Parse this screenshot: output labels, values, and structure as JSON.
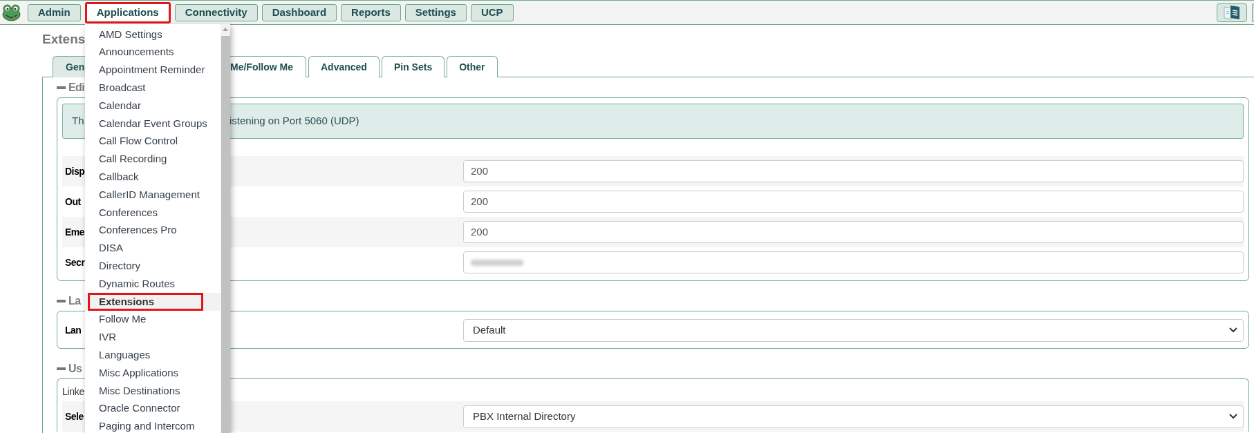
{
  "top_bar": {
    "nav": [
      {
        "label": "Admin",
        "selected": false,
        "highlighted": false
      },
      {
        "label": "Applications",
        "selected": true,
        "highlighted": true
      },
      {
        "label": "Connectivity",
        "selected": false,
        "highlighted": false
      },
      {
        "label": "Dashboard",
        "selected": false,
        "highlighted": false
      },
      {
        "label": "Reports",
        "selected": false,
        "highlighted": false
      },
      {
        "label": "Settings",
        "selected": false,
        "highlighted": false
      },
      {
        "label": "UCP",
        "selected": false,
        "highlighted": false
      }
    ]
  },
  "page_title": "Extens",
  "tabs": [
    {
      "label": "Gen",
      "selected": true
    },
    {
      "label": "Me/Follow Me",
      "selected": false
    },
    {
      "label": "Advanced",
      "selected": false
    },
    {
      "label": "Pin Sets",
      "selected": false
    },
    {
      "label": "Other",
      "selected": false
    }
  ],
  "sections": [
    {
      "heading": "Edi",
      "expanded": true,
      "alert": [
        "Th",
        "istening on Port 5060 (UDP)"
      ],
      "rows": [
        {
          "label": "Disp",
          "kind": "input",
          "value": "200",
          "shaded": true
        },
        {
          "label": "Out",
          "kind": "input",
          "value": "200",
          "shaded": false
        },
        {
          "label": "Eme",
          "kind": "input",
          "value": "200",
          "shaded": true
        },
        {
          "label": "Secr",
          "kind": "input",
          "blurred": true,
          "shaded": false
        }
      ]
    },
    {
      "heading": "La",
      "expanded": true,
      "rows": [
        {
          "label": "Lan",
          "kind": "select",
          "value": "Default",
          "shaded": false
        }
      ]
    },
    {
      "heading": "Us",
      "expanded": true,
      "description": "Linke",
      "rows": [
        {
          "label": "Sele",
          "kind": "select",
          "value": "PBX Internal Directory",
          "shaded": true
        }
      ]
    }
  ],
  "applications_menu": {
    "items": [
      {
        "label": "AMD Settings",
        "selected": false,
        "highlighted": false
      },
      {
        "label": "Announcements",
        "selected": false,
        "highlighted": false
      },
      {
        "label": "Appointment Reminder",
        "selected": false,
        "highlighted": false
      },
      {
        "label": "Broadcast",
        "selected": false,
        "highlighted": false
      },
      {
        "label": "Calendar",
        "selected": false,
        "highlighted": false
      },
      {
        "label": "Calendar Event Groups",
        "selected": false,
        "highlighted": false
      },
      {
        "label": "Call Flow Control",
        "selected": false,
        "highlighted": false
      },
      {
        "label": "Call Recording",
        "selected": false,
        "highlighted": false
      },
      {
        "label": "Callback",
        "selected": false,
        "highlighted": false
      },
      {
        "label": "CallerID Management",
        "selected": false,
        "highlighted": false
      },
      {
        "label": "Conferences",
        "selected": false,
        "highlighted": false
      },
      {
        "label": "Conferences Pro",
        "selected": false,
        "highlighted": false
      },
      {
        "label": "DISA",
        "selected": false,
        "highlighted": false
      },
      {
        "label": "Directory",
        "selected": false,
        "highlighted": false
      },
      {
        "label": "Dynamic Routes",
        "selected": false,
        "highlighted": false
      },
      {
        "label": "Extensions",
        "selected": true,
        "highlighted": true
      },
      {
        "label": "Follow Me",
        "selected": false,
        "highlighted": false
      },
      {
        "label": "IVR",
        "selected": false,
        "highlighted": false
      },
      {
        "label": "Languages",
        "selected": false,
        "highlighted": false
      },
      {
        "label": "Misc Applications",
        "selected": false,
        "highlighted": false
      },
      {
        "label": "Misc Destinations",
        "selected": false,
        "highlighted": false
      },
      {
        "label": "Oracle Connector",
        "selected": false,
        "highlighted": false
      },
      {
        "label": "Paging and Intercom",
        "selected": false,
        "highlighted": false
      }
    ]
  }
}
